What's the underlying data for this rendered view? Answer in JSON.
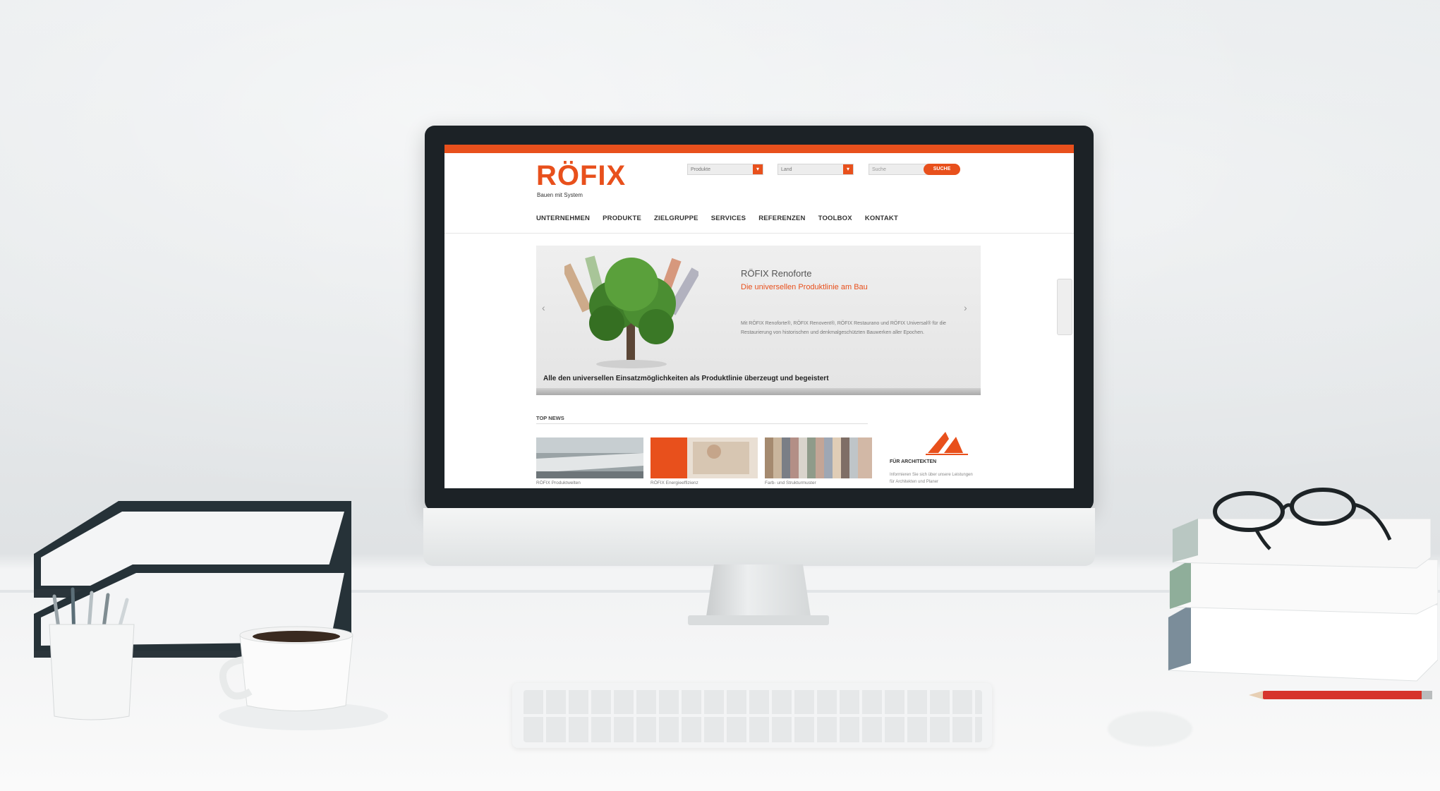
{
  "site": {
    "logo_text": "RÖFIX",
    "tagline": "Bauen mit System",
    "header": {
      "select_1": "Produkte",
      "select_2": "Land",
      "search_placeholder": "Suche",
      "search_button": "SUCHE"
    },
    "nav": [
      "UNTERNEHMEN",
      "PRODUKTE",
      "ZIELGRUPPE",
      "SERVICES",
      "REFERENZEN",
      "TOOLBOX",
      "KONTAKT"
    ],
    "slider": {
      "title": "RÖFIX Renoforte",
      "subtitle": "Die universellen Produktlinie am Bau",
      "text": "Mit RÖFIX Renoforte®, RÖFIX Renovent®, RÖFIX Restaurano und RÖFIX Universal® für die Restaurierung von historischen und denkmalgeschützten Bauwerken aller Epochen.",
      "caption": "Alle den universellen Einsatzmöglichkeiten als Produktlinie überzeugt und begeistert",
      "prev": "‹",
      "next": "›"
    },
    "top_section": {
      "title": "TOP NEWS",
      "thumbs": [
        {
          "caption": "RÖFIX Produktwelten"
        },
        {
          "caption": "RÖFIX Energieeffizienz"
        },
        {
          "caption": "Farb- und Strukturmuster"
        }
      ],
      "arch": {
        "title": "FÜR ARCHITEKTEN",
        "text": "Informieren Sie sich über unsere Leistungen für Architekten und Planer"
      }
    }
  },
  "colors": {
    "brand": "#e8501c",
    "bezel": "#1c2226",
    "page_bg": "#ffffff"
  }
}
